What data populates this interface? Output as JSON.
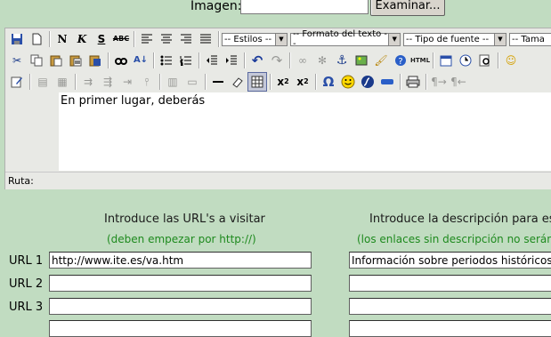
{
  "file_row": {
    "label": "Imagen:",
    "value": "",
    "browse_button": "Examinar..."
  },
  "toolbar": {
    "row1_icons": [
      "save-icon",
      "new-page-icon",
      "bold-icon",
      "italic-icon",
      "underline-icon",
      "strikethrough-icon",
      "align-left-icon",
      "align-center-icon",
      "align-right-icon",
      "justify-icon"
    ],
    "bold_glyph": "N",
    "italic_glyph": "K",
    "underline_glyph": "S",
    "strike_glyph": "ABC",
    "style_select": "-- Estilos --",
    "format_select": "-- Formato del texto --",
    "font_select": "-- Tipo de fuente --",
    "size_select": "-- Tama"
  },
  "editor": {
    "content": "En primer lugar, deberás",
    "path_label": "Ruta:"
  },
  "form": {
    "urls_header": "Introduce las URL's a visitar",
    "urls_hint": "(deben empezar por http://)",
    "desc_header": "Introduce la descripción para esa",
    "desc_hint": "(los enlaces sin descripción no serán g",
    "rows": [
      {
        "label": "URL 1",
        "url": "http://www.ite.es/va.htm",
        "description": "Información sobre periodos históricos"
      },
      {
        "label": "URL 2",
        "url": "",
        "description": ""
      },
      {
        "label": "URL 3",
        "url": "",
        "description": ""
      }
    ]
  }
}
